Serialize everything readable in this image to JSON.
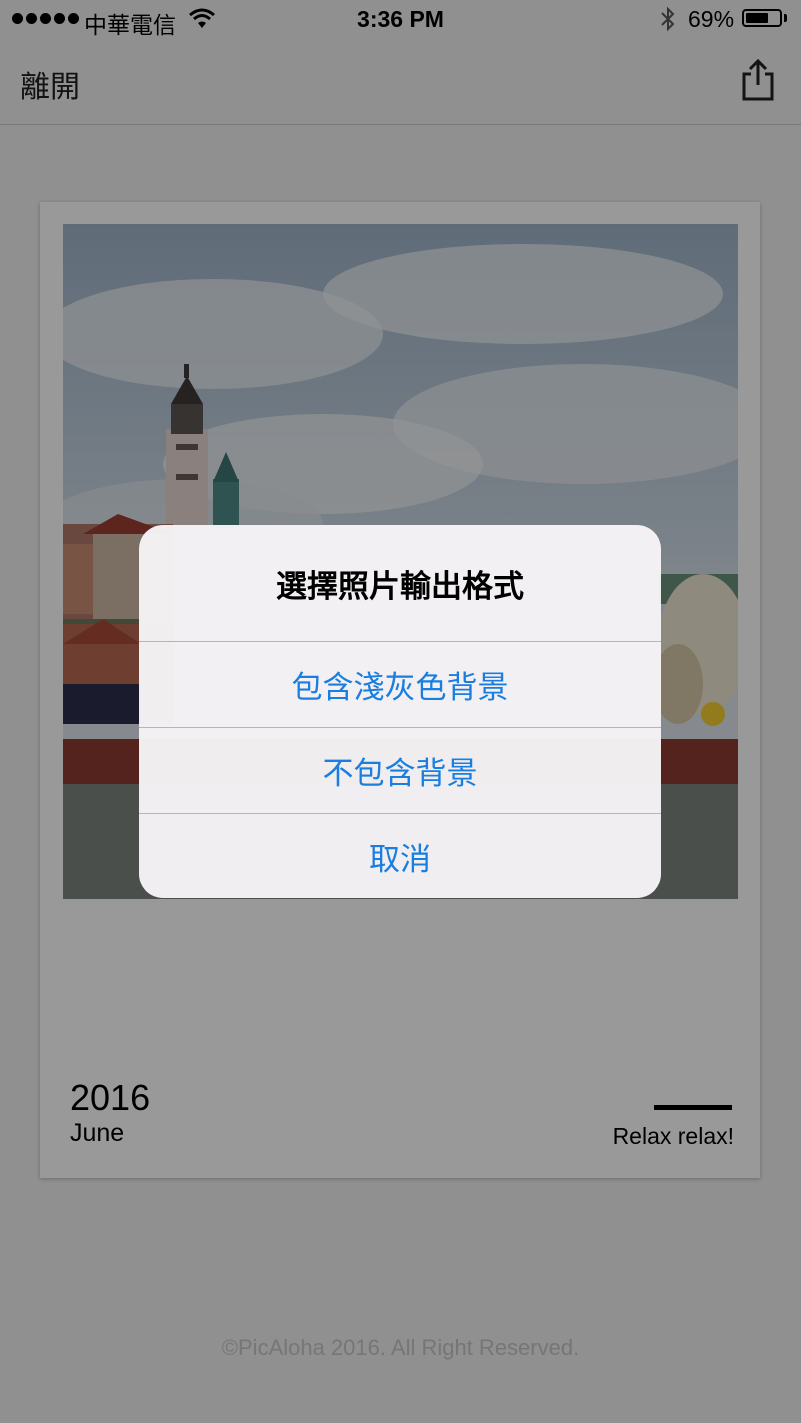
{
  "status_bar": {
    "carrier": "中華電信",
    "time": "3:36 PM",
    "battery_text": "69%",
    "battery_level": 0.69
  },
  "nav": {
    "exit_label": "離開",
    "share_icon": "share-icon"
  },
  "card": {
    "year": "2016",
    "month": "June",
    "caption": "Relax relax!"
  },
  "footer": {
    "copyright": "©PicAloha 2016. All Right Reserved."
  },
  "alert": {
    "title": "選擇照片輸出格式",
    "option_1": "包含淺灰色背景",
    "option_2": "不包含背景",
    "cancel": "取消"
  },
  "colors": {
    "ios_blue": "#1a7ee0",
    "overlay": "rgba(0,0,0,0.4)"
  }
}
